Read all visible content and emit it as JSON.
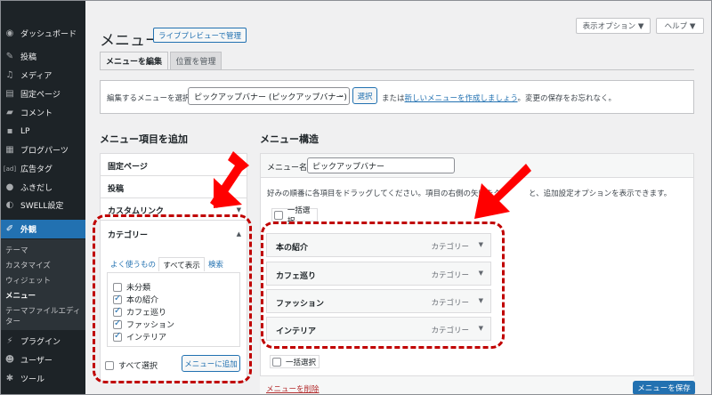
{
  "sidebar": {
    "items": [
      {
        "label": "ダッシュボード",
        "icon": "dashboard-icon"
      },
      {
        "label": "投稿",
        "icon": "pin-icon"
      },
      {
        "label": "メディア",
        "icon": "media-icon"
      },
      {
        "label": "固定ページ",
        "icon": "page-icon"
      },
      {
        "label": "コメント",
        "icon": "comment-icon"
      },
      {
        "label": "LP",
        "icon": "lp-icon"
      },
      {
        "label": "ブログパーツ",
        "icon": "blogparts-icon"
      },
      {
        "label": "広告タグ",
        "icon": "ad-icon"
      },
      {
        "label": "ふきだし",
        "icon": "balloon-icon"
      },
      {
        "label": "SWELL設定",
        "icon": "swell-icon"
      },
      {
        "label": "外観",
        "icon": "brush-icon"
      },
      {
        "label": "プラグイン",
        "icon": "plugin-icon"
      },
      {
        "label": "ユーザー",
        "icon": "user-icon"
      },
      {
        "label": "ツール",
        "icon": "tool-icon"
      }
    ],
    "subitems": [
      "テーマ",
      "カスタマイズ",
      "ウィジェット",
      "メニュー",
      "テーマファイルエディ",
      "ター"
    ]
  },
  "header": {
    "screen_options": "表示オプション ▼",
    "help": "ヘルプ ▼",
    "title": "メニュー",
    "live_preview": "ライブプレビューで管理"
  },
  "tabs": {
    "edit": "メニューを編集",
    "manage": "位置を管理"
  },
  "select_bar": {
    "label": "編集するメニューを選択:",
    "selected": "ピックアップバナー (ピックアップバナー)",
    "select_button": "選択",
    "or": "または",
    "create_link": "新しいメニューを作成しましょう",
    "note": "。変更の保存をお忘れなく。"
  },
  "add_items": {
    "heading": "メニュー項目を追加",
    "sections": [
      "固定ページ",
      "投稿",
      "カスタムリンク",
      "カテゴリー"
    ],
    "category_tabs": [
      "よく使うもの",
      "すべて表示",
      "検索"
    ],
    "categories": [
      {
        "label": "未分類",
        "checked": false
      },
      {
        "label": "本の紹介",
        "checked": true
      },
      {
        "label": "カフェ巡り",
        "checked": true
      },
      {
        "label": "ファッション",
        "checked": true
      },
      {
        "label": "インテリア",
        "checked": true
      }
    ],
    "select_all": "すべて選択",
    "add_button": "メニューに追加"
  },
  "structure": {
    "heading": "メニュー構造",
    "name_label": "メニュー名",
    "name_value": "ピックアップバナー",
    "instructions_a": "好みの順番に各項目をドラッグしてください。項目の右側の矢印をク",
    "instructions_b": "と、追加設定オプションを表示できます。",
    "bulk_select": "一括選択",
    "items": [
      {
        "title": "本の紹介",
        "type": "カテゴリー"
      },
      {
        "title": "カフェ巡り",
        "type": "カテゴリー"
      },
      {
        "title": "ファッション",
        "type": "カテゴリー"
      },
      {
        "title": "インテリア",
        "type": "カテゴリー"
      }
    ],
    "delete_link": "メニューを削除",
    "save_button": "メニューを保存"
  },
  "colors": {
    "accent": "#2271b1",
    "sidebar": "#1d2327",
    "annotation": "#c00000",
    "arrow": "#ff0000"
  }
}
